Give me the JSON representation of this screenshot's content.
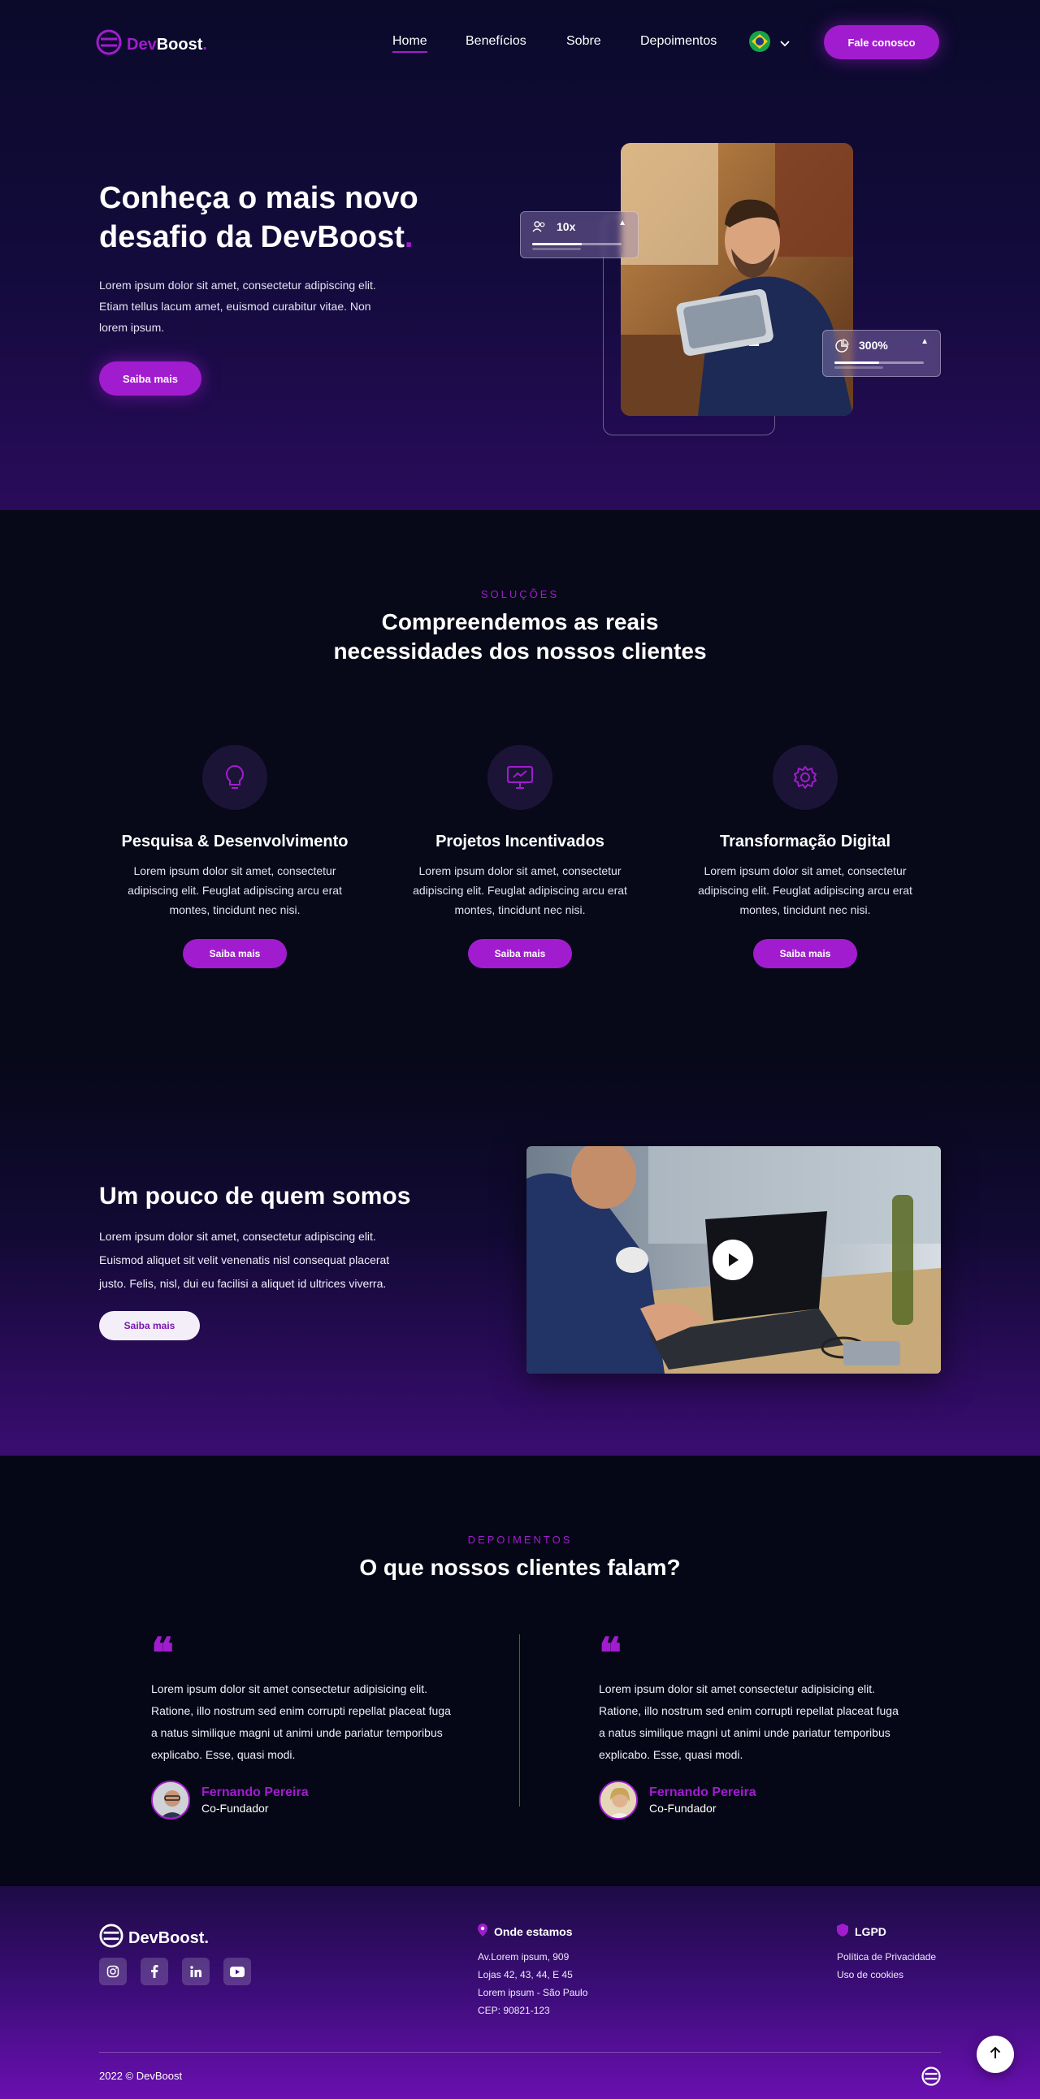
{
  "brand": {
    "name_part1": "Dev",
    "name_part2": "Boost",
    "dot": "."
  },
  "nav": {
    "links": [
      {
        "label": "Home",
        "active": true
      },
      {
        "label": "Benefícios"
      },
      {
        "label": "Sobre"
      },
      {
        "label": "Depoimentos"
      }
    ],
    "language": "flag-brazil-icon",
    "cta_label": "Fale conosco"
  },
  "hero": {
    "title": "Conheça o mais novo desafio da DevBoost",
    "title_dot": ".",
    "lead": "Lorem ipsum dolor sit amet, consectetur adipiscing elit. Etiam tellus lacum amet, euismod curabitur vitae. Non lorem ipsum.",
    "cta_label": "Saiba mais",
    "stat1": {
      "icon": "users-icon",
      "value": "10x",
      "progress": 0.55
    },
    "stat2": {
      "icon": "pie-chart-icon",
      "value": "300%",
      "progress": 0.5
    }
  },
  "solutions": {
    "eyebrow": "SOLUÇÕES",
    "title_line1": "Compreendemos as reais",
    "title_line2": "necessidades dos nossos clientes",
    "cards": [
      {
        "icon": "lightbulb-icon",
        "title": "Pesquisa & Desenvolvimento",
        "text": "Lorem ipsum dolor sit amet, consectetur adipiscing elit. Feuglat adipiscing arcu erat montes, tincidunt nec nisi.",
        "cta": "Saiba mais"
      },
      {
        "icon": "monitor-icon",
        "title": "Projetos Incentivados",
        "text": "Lorem ipsum dolor sit amet, consectetur adipiscing elit. Feuglat adipiscing arcu erat montes, tincidunt nec nisi.",
        "cta": "Saiba mais"
      },
      {
        "icon": "gear-icon",
        "title": "Transformação Digital",
        "text": "Lorem ipsum dolor sit amet, consectetur adipiscing elit. Feuglat adipiscing arcu erat montes, tincidunt nec nisi.",
        "cta": "Saiba mais"
      }
    ]
  },
  "about": {
    "title": "Um pouco de quem somos",
    "text": "Lorem ipsum dolor sit amet, consectetur adipiscing elit. Euismod aliquet sit velit venenatis nisl consequat placerat justo. Felis, nisl, dui eu facilisi a aliquet id ultrices viverra.",
    "cta_label": "Saiba mais",
    "video_icon": "play-icon"
  },
  "testimonials": {
    "eyebrow": "DEPOIMENTOS",
    "title": "O que nossos clientes falam?",
    "items": [
      {
        "text": "Lorem ipsum dolor sit amet consectetur adipisicing elit. Ratione, illo nostrum sed enim corrupti repellat placeat fuga a natus similique magni ut animi unde pariatur temporibus explicabo. Esse, quasi modi.",
        "name": "Fernando Pereira",
        "role": "Co-Fundador"
      },
      {
        "text": "Lorem ipsum dolor sit amet consectetur adipisicing elit. Ratione, illo nostrum sed enim corrupti repellat placeat fuga a natus similique magni ut animi unde pariatur temporibus explicabo. Esse, quasi modi.",
        "name": "Fernando Pereira",
        "role": "Co-Fundador"
      }
    ]
  },
  "footer": {
    "brand": "DevBoost.",
    "social": [
      "instagram-icon",
      "facebook-icon",
      "linkedin-icon",
      "youtube-icon"
    ],
    "location_title": "Onde estamos",
    "address": [
      "Av.Lorem ipsum, 909",
      "Lojas 42, 43, 44, E 45",
      "Lorem ipsum - São Paulo",
      "CEP: 90821-123"
    ],
    "lgpd_title": "LGPD",
    "lgpd_links": [
      "Política de Privacidade",
      "Uso de cookies"
    ],
    "copyright": "2022 © DevBoost"
  },
  "colors": {
    "accent": "#a21ccf",
    "dark": "#050716"
  }
}
